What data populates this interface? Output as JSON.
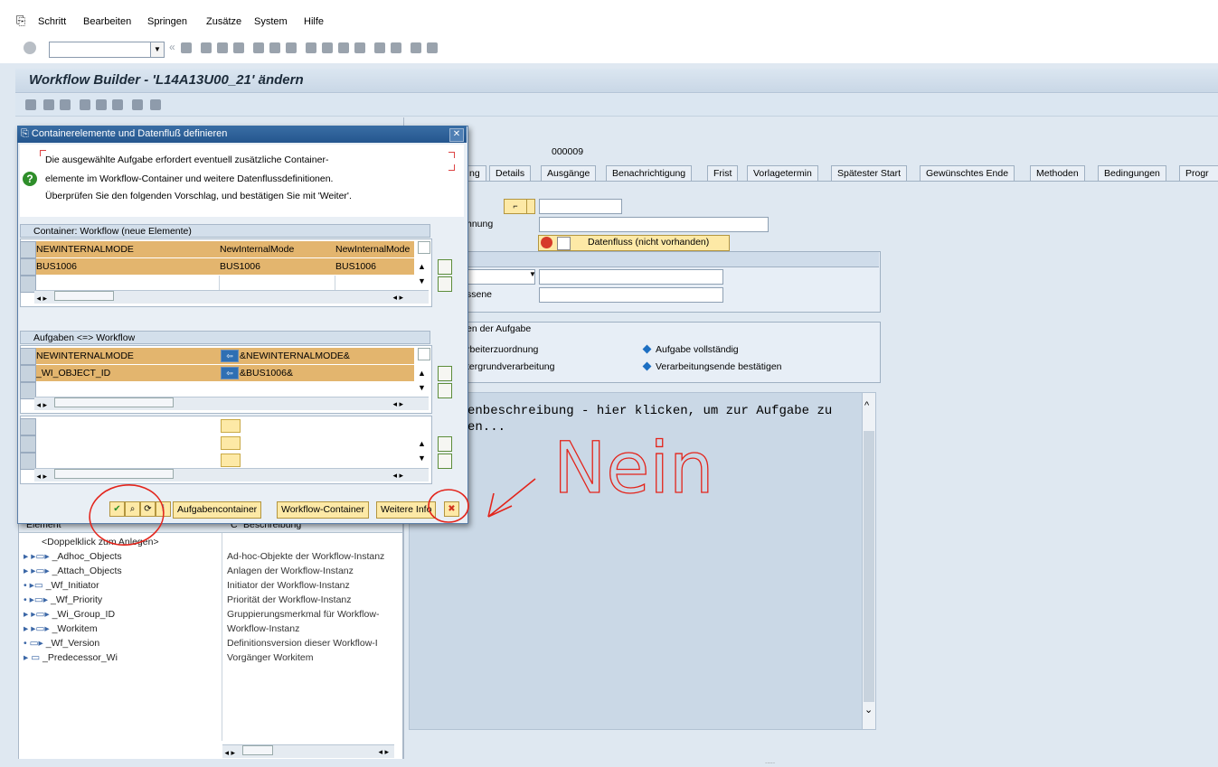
{
  "menu": {
    "items": [
      "Schritt",
      "Bearbeiten",
      "Springen",
      "Zusätze",
      "System",
      "Hilfe"
    ]
  },
  "title": "Workflow Builder - 'L14A13U00_21' ändern",
  "step_number": "000009",
  "tabs": [
    "ng",
    "Details",
    "Ausgänge",
    "Benachrichtigung",
    "Frist",
    "Vorlagetermin",
    "Spätester Start",
    "Gewünschtes Ende",
    "Methoden",
    "Bedingungen",
    "Progr"
  ],
  "right": {
    "label_nnung": "hnung",
    "label_ssene": "ssene",
    "dataflow_button": "Datenfluss (nicht vorhanden)",
    "group_title": "en der Aufgabe",
    "opt1": "rbeiterzuordnung",
    "opt2": "tergrundverarbeitung",
    "opt3": "Aufgabe vollständig",
    "opt4": "Verarbeitungsende bestätigen",
    "text_line1": "enbeschreibung - hier klicken, um zur Aufgabe zu",
    "text_line2": "en..."
  },
  "left_tree": {
    "col_element": "Element",
    "col_c": "C",
    "col_desc": "Beschreibung",
    "items": [
      {
        "name": "<Doppelklick zum Anlegen>",
        "desc": ""
      },
      {
        "name": "_Adhoc_Objects",
        "desc": "Ad-hoc-Objekte der Workflow-Instanz"
      },
      {
        "name": "_Attach_Objects",
        "desc": "Anlagen der Workflow-Instanz"
      },
      {
        "name": "_Wf_Initiator",
        "desc": "Initiator der Workflow-Instanz"
      },
      {
        "name": "_Wf_Priority",
        "desc": "Priorität der Workflow-Instanz"
      },
      {
        "name": "_Wi_Group_ID",
        "desc": "Gruppierungsmerkmal für Workflow-"
      },
      {
        "name": "_Workitem",
        "desc": "Workflow-Instanz"
      },
      {
        "name": "_Wf_Version",
        "desc": "Definitionsversion dieser Workflow-I"
      },
      {
        "name": "_Predecessor_Wi",
        "desc": "Vorgänger Workitem"
      }
    ]
  },
  "dialog": {
    "title": "Containerelemente und Datenfluß definieren",
    "msg1": "Die ausgewählte Aufgabe erfordert eventuell zusätzliche Container-",
    "msg2": "elemente im Workflow-Container und weitere Datenflussdefinitionen.",
    "msg3": "Überprüfen Sie den folgenden Vorschlag, und bestätigen Sie mit 'Weiter'.",
    "container_head": "Container: Workflow (neue Elemente)",
    "c_row1": [
      "NEWINTERNALMODE",
      "NewInternalMode",
      "NewInternalMode"
    ],
    "c_row2": [
      "BUS1006",
      "BUS1006",
      "BUS1006"
    ],
    "mapping_head": "Aufgaben <=> Workflow",
    "m_row1": [
      "NEWINTERNALMODE",
      "&NEWINTERNALMODE&"
    ],
    "m_row2": [
      "_WI_OBJECT_ID",
      "&BUS1006&"
    ],
    "btn_task_container": "Aufgabencontainer",
    "btn_wf_container": "Workflow-Container",
    "btn_more_info": "Weitere Info"
  },
  "annotation_text": "Nein"
}
